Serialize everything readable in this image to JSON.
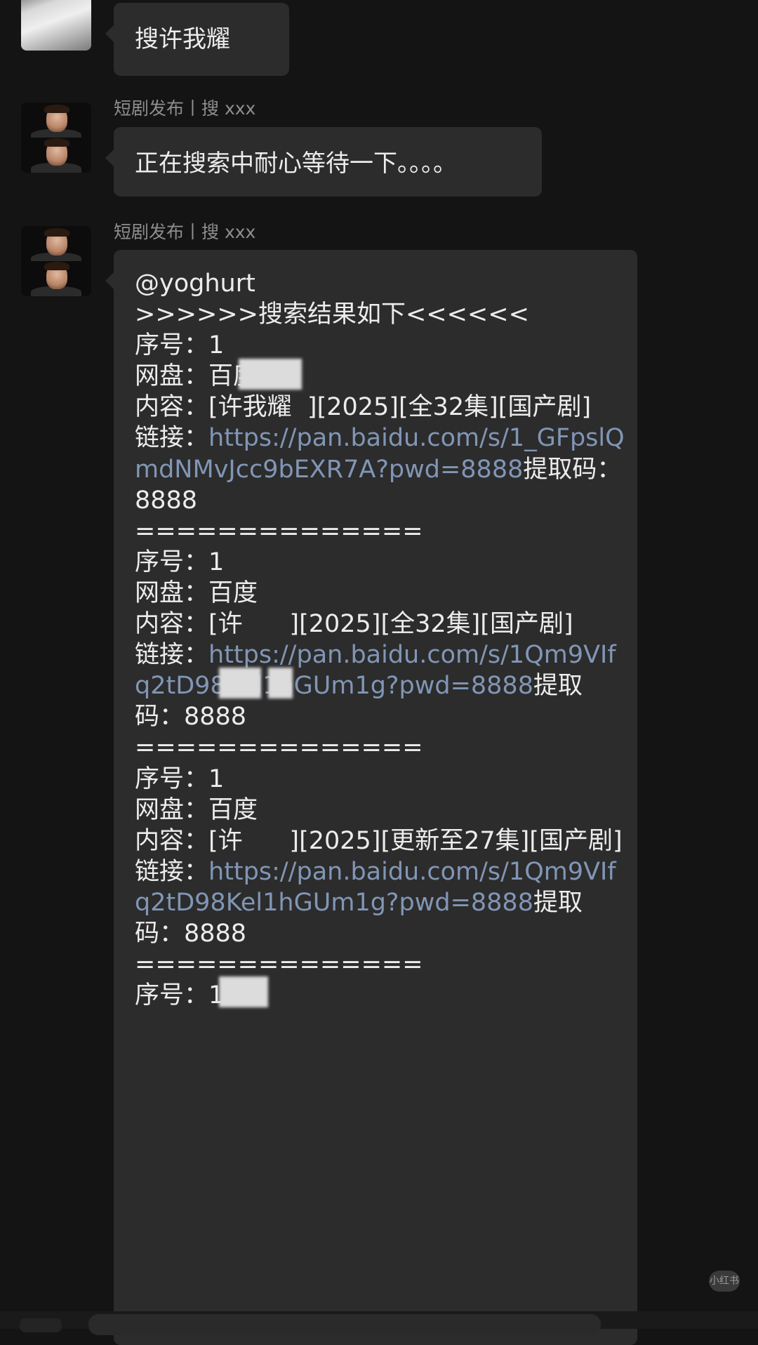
{
  "messages": {
    "m1": {
      "text": "搜许我耀"
    },
    "m2": {
      "sender": "短剧发布丨搜 xxx",
      "text": "正在搜索中耐心等待一下。。。。"
    },
    "m3": {
      "sender": "短剧发布丨搜 xxx",
      "mention": "@yoghurt",
      "header": ">>>>>>搜索结果如下<<<<<<",
      "separator": "==============",
      "results": [
        {
          "index_label": "序号：",
          "index": "1",
          "disk_label": "网盘：",
          "disk": "百度",
          "content_label": "内容：",
          "content": "[许我耀  ][2025][全32集][国产剧]",
          "link_label": "链接：",
          "link": "https://pan.baidu.com/s/1_GFpslQmdNMvJcc9bEXR7A?pwd=8888",
          "code": "提取码：8888"
        },
        {
          "index_label": "序号：",
          "index": "1",
          "disk_label": "网盘：",
          "disk": "百度",
          "content_label": "内容：",
          "content": "[许      ][2025][全32集][国产剧]",
          "link_label": "链接：",
          "link": "https://pan.baidu.com/s/1Qm9VIfq2tD98Kel1hGUm1g?pwd=8888",
          "code": "提取码：8888"
        },
        {
          "index_label": "序号：",
          "index": "1",
          "disk_label": "网盘：",
          "disk": "百度",
          "content_label": "内容：",
          "content": "[许      ][2025][更新至27集][国产剧]",
          "link_label": "链接：",
          "link": "https://pan.baidu.com/s/1Qm9VIfq2tD98Kel1hGUm1g?pwd=8888",
          "code": "提取码：8888"
        }
      ],
      "trailing_index_label": "序号：",
      "trailing_index": "1"
    }
  },
  "watermark": "小红书",
  "colors": {
    "background": "#141414",
    "bubble": "#2c2c2c",
    "link": "#8196b6",
    "sender": "#8e8e8e"
  }
}
